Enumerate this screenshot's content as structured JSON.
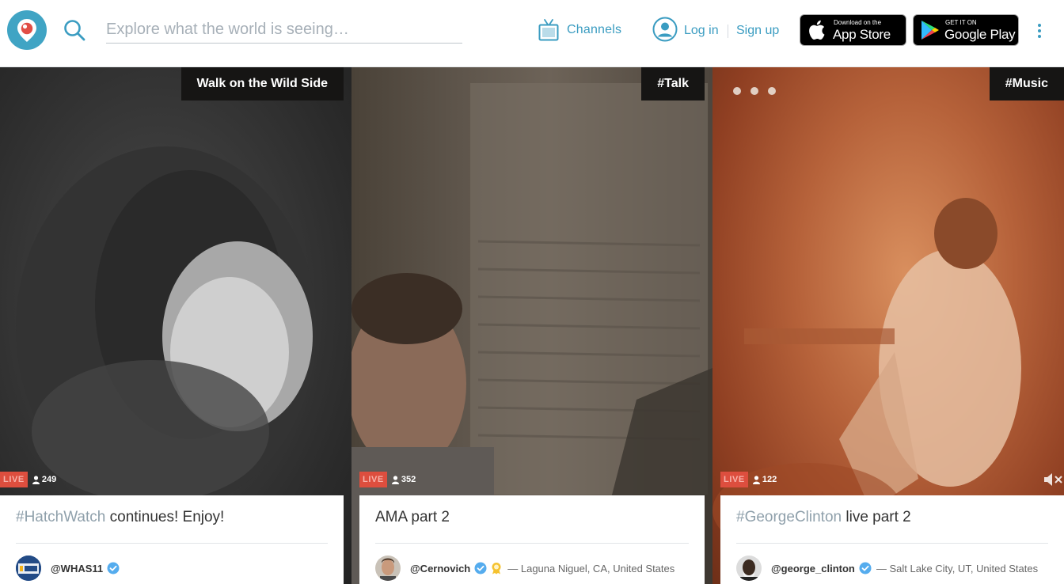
{
  "header": {
    "logo_icon": "periscope-logo-icon",
    "search_icon": "search-icon",
    "search_placeholder": "Explore what the world is seeing…",
    "channels_icon": "tv-icon",
    "channels_label": "Channels",
    "account_icon": "user-circle-icon",
    "login_label": "Log in",
    "signup_label": "Sign up",
    "app_store": {
      "small": "Download on the",
      "big": "App Store"
    },
    "google_play": {
      "small": "GET IT ON",
      "big": "Google Play"
    },
    "more_icon": "vertical-dots-icon"
  },
  "colors": {
    "brand": "#40a4c4",
    "link": "#3a9cc1",
    "live": "#dd4e3e",
    "verified": "#55acee"
  },
  "broadcasts": [
    {
      "tag": "Walk on the Wild Side",
      "live_label": "LIVE",
      "viewers": "249",
      "title_hashtag": "#HatchWatch",
      "title_rest": " continues! Enjoy!",
      "username": "@WHAS11",
      "verified": true,
      "location": ""
    },
    {
      "tag": "#Talk",
      "live_label": "LIVE",
      "viewers": "352",
      "title_hashtag": "",
      "title_rest": "AMA part 2",
      "username": "@Cernovich",
      "verified": true,
      "location": "— Laguna Niguel, CA, United States"
    },
    {
      "tag": "#Music",
      "live_label": "LIVE",
      "viewers": "122",
      "title_hashtag": "#GeorgeClinton",
      "title_rest": " live part 2",
      "username": "@george_clinton",
      "verified": true,
      "location": "— Salt Lake City, UT, United States"
    }
  ]
}
